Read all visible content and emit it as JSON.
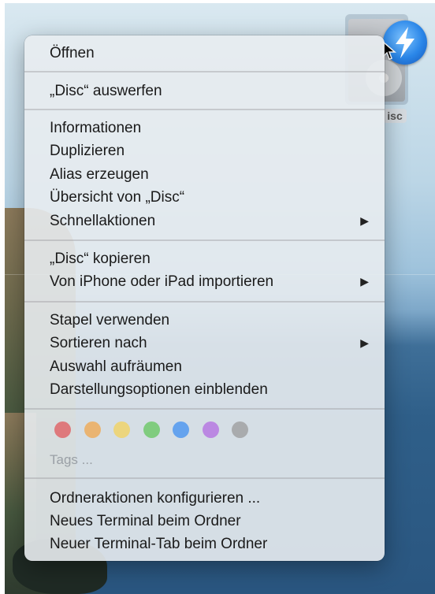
{
  "desktop": {
    "disc_label": "isc"
  },
  "menu": {
    "open": "Öffnen",
    "eject": "„Disc“ auswerfen",
    "get_info": "Informationen",
    "duplicate": "Duplizieren",
    "make_alias": "Alias erzeugen",
    "quick_look": "Übersicht von „Disc“",
    "quick_actions": "Schnellaktionen",
    "copy": "„Disc“ kopieren",
    "import_device": "Von iPhone oder iPad importieren",
    "use_stacks": "Stapel verwenden",
    "sort_by": "Sortieren nach",
    "clean_up": "Auswahl aufräumen",
    "view_options": "Darstellungsoptionen einblenden",
    "tags_label": "Tags ...",
    "folder_actions": "Ordneraktionen konfigurieren ...",
    "new_terminal": "Neues Terminal beim Ordner",
    "new_terminal_tab": "Neuer Terminal-Tab beim Ordner",
    "submenu_arrow": "▶"
  },
  "tag_colors": [
    "#e0575b",
    "#f0a54b",
    "#f3d15a",
    "#63c55c",
    "#3f8ff0",
    "#b26be0",
    "#9a9a9a"
  ],
  "tag_names": [
    "red-tag",
    "orange-tag",
    "yellow-tag",
    "green-tag",
    "blue-tag",
    "purple-tag",
    "gray-tag"
  ]
}
